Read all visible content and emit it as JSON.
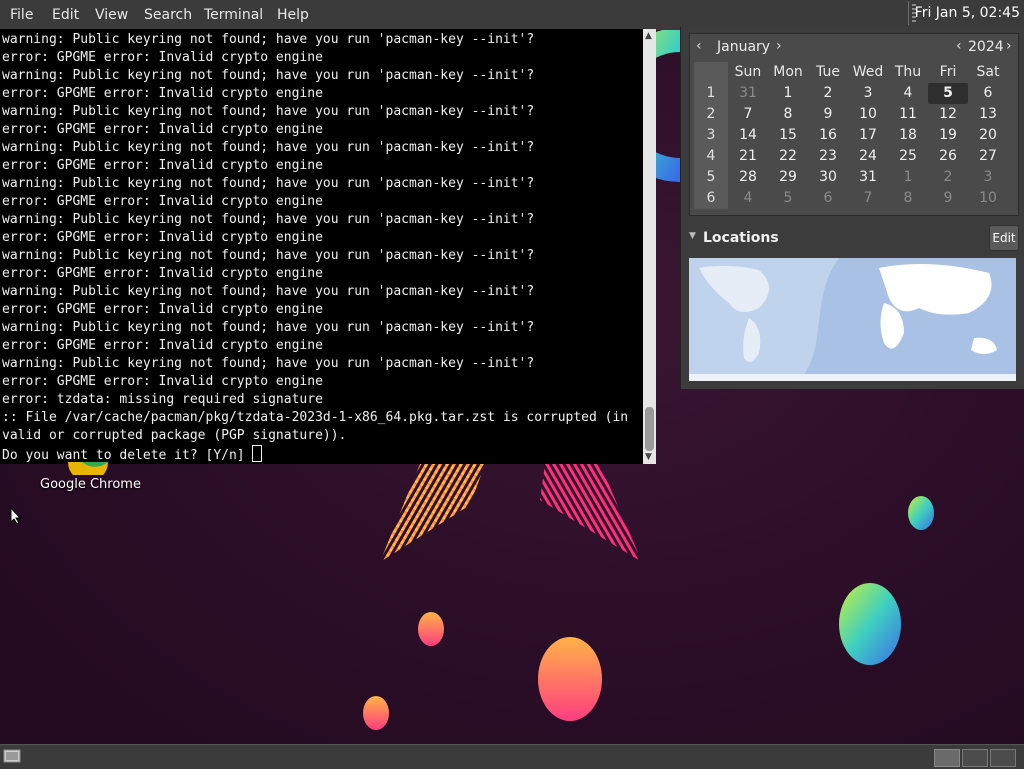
{
  "menubar": {
    "items": [
      "File",
      "Edit",
      "View",
      "Search",
      "Terminal",
      "Help"
    ],
    "clock": "Fri Jan  5, 02:45"
  },
  "terminal": {
    "lines": [
      "warning: Public keyring not found; have you run 'pacman-key --init'?",
      "error: GPGME error: Invalid crypto engine",
      "warning: Public keyring not found; have you run 'pacman-key --init'?",
      "error: GPGME error: Invalid crypto engine",
      "warning: Public keyring not found; have you run 'pacman-key --init'?",
      "error: GPGME error: Invalid crypto engine",
      "warning: Public keyring not found; have you run 'pacman-key --init'?",
      "error: GPGME error: Invalid crypto engine",
      "warning: Public keyring not found; have you run 'pacman-key --init'?",
      "error: GPGME error: Invalid crypto engine",
      "warning: Public keyring not found; have you run 'pacman-key --init'?",
      "error: GPGME error: Invalid crypto engine",
      "warning: Public keyring not found; have you run 'pacman-key --init'?",
      "error: GPGME error: Invalid crypto engine",
      "warning: Public keyring not found; have you run 'pacman-key --init'?",
      "error: GPGME error: Invalid crypto engine",
      "warning: Public keyring not found; have you run 'pacman-key --init'?",
      "error: GPGME error: Invalid crypto engine",
      "warning: Public keyring not found; have you run 'pacman-key --init'?",
      "error: GPGME error: Invalid crypto engine",
      "error: tzdata: missing required signature",
      ":: File /var/cache/pacman/pkg/tzdata-2023d-1-x86_64.pkg.tar.zst is corrupted (in",
      "valid or corrupted package (PGP signature))."
    ],
    "prompt": "Do you want to delete it? [Y/n] "
  },
  "desktop": {
    "chrome_label": "Google Chrome"
  },
  "calendar": {
    "month": "January",
    "year": "2024",
    "weekdays": [
      "Sun",
      "Mon",
      "Tue",
      "Wed",
      "Thu",
      "Fri",
      "Sat"
    ],
    "weeks": [
      {
        "num": "1",
        "days": [
          "31",
          "1",
          "2",
          "3",
          "4",
          "5",
          "6"
        ]
      },
      {
        "num": "2",
        "days": [
          "7",
          "8",
          "9",
          "10",
          "11",
          "12",
          "13"
        ]
      },
      {
        "num": "3",
        "days": [
          "14",
          "15",
          "16",
          "17",
          "18",
          "19",
          "20"
        ]
      },
      {
        "num": "4",
        "days": [
          "21",
          "22",
          "23",
          "24",
          "25",
          "26",
          "27"
        ]
      },
      {
        "num": "5",
        "days": [
          "28",
          "29",
          "30",
          "31",
          "1",
          "2",
          "3"
        ]
      },
      {
        "num": "6",
        "days": [
          "4",
          "5",
          "6",
          "7",
          "8",
          "9",
          "10"
        ]
      }
    ],
    "today": "5",
    "locations_title": "Locations",
    "edit_label": "Edit"
  },
  "icons": {
    "prev": "chevron-left-icon",
    "next": "chevron-right-icon",
    "expander": "triangle-down-icon"
  },
  "colors": {
    "panel": "#3b3b3b",
    "terminal_bg": "#000000",
    "wallpaper": "#2a0d26"
  }
}
